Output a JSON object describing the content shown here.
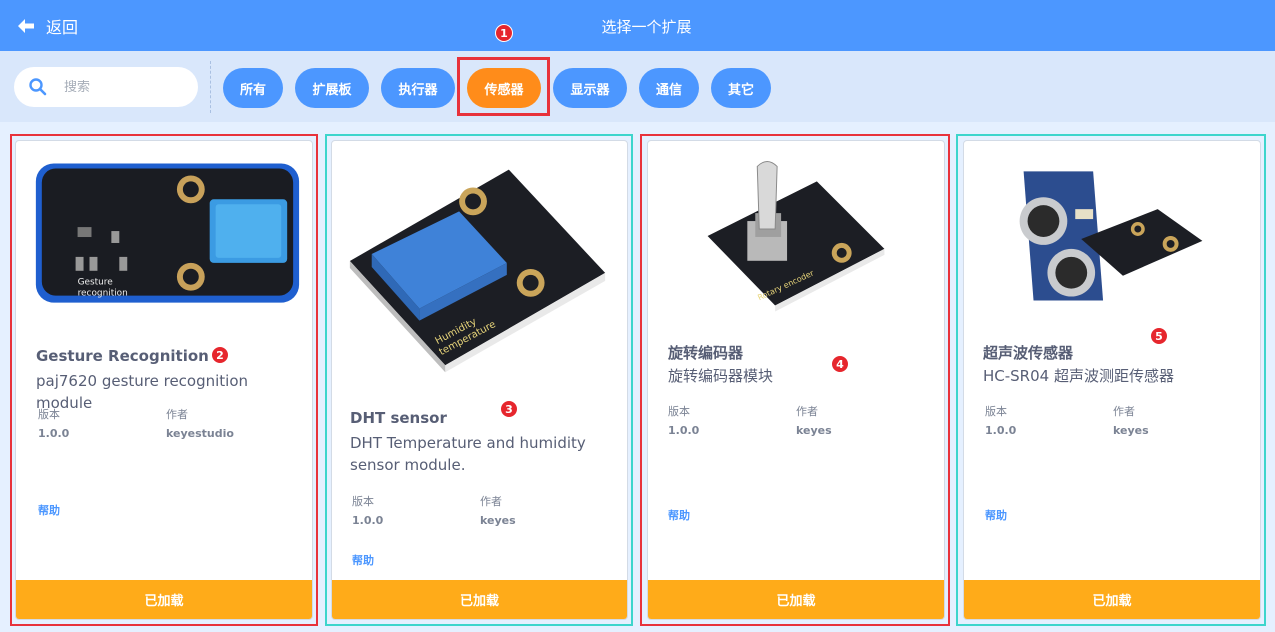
{
  "header": {
    "back_label": "返回",
    "title": "选择一个扩展"
  },
  "search": {
    "placeholder": "搜索"
  },
  "categories": [
    {
      "label": "所有"
    },
    {
      "label": "扩展板"
    },
    {
      "label": "执行器"
    },
    {
      "label": "传感器",
      "active": true
    },
    {
      "label": "显示器"
    },
    {
      "label": "通信"
    },
    {
      "label": "其它"
    }
  ],
  "badges": [
    "1",
    "2",
    "3",
    "4",
    "5"
  ],
  "labels": {
    "version": "版本",
    "author": "作者",
    "help": "帮助",
    "loaded": "已加载"
  },
  "cards": [
    {
      "name": "Gesture Recognition",
      "description": "paj7620 gesture recognition module",
      "version": "1.0.0",
      "author": "keyestudio",
      "image_text": [
        "Gesture",
        "recognition"
      ]
    },
    {
      "name": "DHT sensor",
      "description": "DHT Temperature and humidity sensor module.",
      "version": "1.0.0",
      "author": "keyes",
      "image_text": [
        "Humidity",
        "temperature"
      ]
    },
    {
      "name": "旋转编码器",
      "description": "旋转编码器模块",
      "version": "1.0.0",
      "author": "keyes",
      "image_text": [
        "Rotary encoder"
      ]
    },
    {
      "name": "超声波传感器",
      "description": "HC-SR04 超声波测距传感器",
      "version": "1.0.0",
      "author": "keyes"
    }
  ],
  "colors": {
    "primary": "#4c97ff",
    "active": "#ff8c1a",
    "loaded": "#ffab19",
    "highlight_red": "#e8323b",
    "highlight_cyan": "#3dd5cc"
  }
}
